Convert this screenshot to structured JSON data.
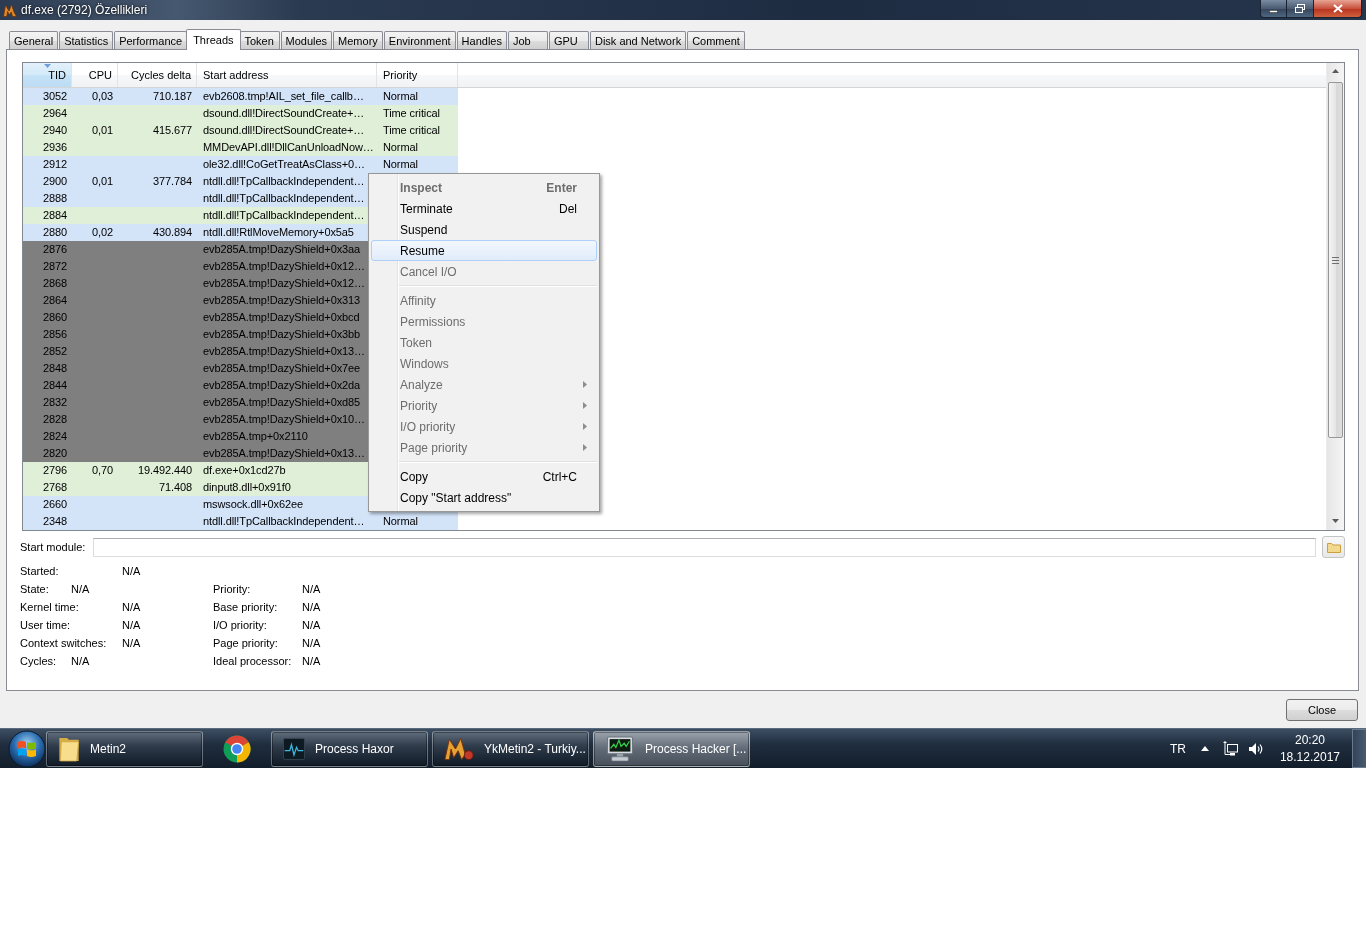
{
  "window": {
    "title": "df.exe (2792) Özellikleri"
  },
  "tabs": [
    {
      "label": "General",
      "selected": false
    },
    {
      "label": "Statistics",
      "selected": false
    },
    {
      "label": "Performance",
      "selected": false
    },
    {
      "label": "Threads",
      "selected": true
    },
    {
      "label": "Token",
      "selected": false
    },
    {
      "label": "Modules",
      "selected": false
    },
    {
      "label": "Memory",
      "selected": false
    },
    {
      "label": "Environment",
      "selected": false
    },
    {
      "label": "Handles",
      "selected": false
    },
    {
      "label": "Job",
      "selected": false
    },
    {
      "label": "GPU",
      "selected": false
    },
    {
      "label": "Disk and Network",
      "selected": false
    },
    {
      "label": "Comment",
      "selected": false
    }
  ],
  "threads": {
    "columns": [
      {
        "label": "TID",
        "kind": "number",
        "sorted": true
      },
      {
        "label": "CPU",
        "kind": "number",
        "sorted": false
      },
      {
        "label": "Cycles delta",
        "kind": "number",
        "sorted": false
      },
      {
        "label": "Start address",
        "kind": "text",
        "sorted": false
      },
      {
        "label": "Priority",
        "kind": "text",
        "sorted": false
      }
    ],
    "rows": [
      {
        "tid": "3052",
        "cpu": "0,03",
        "cycles_delta": "710.187",
        "start_address": "evb2608.tmp!AIL_set_file_callb…",
        "priority": "Normal",
        "color": "#d3e3f8"
      },
      {
        "tid": "2964",
        "start_address": "dsound.dll!DirectSoundCreate+…",
        "priority": "Time critical",
        "color": "#e0efd8"
      },
      {
        "tid": "2940",
        "cpu": "0,01",
        "cycles_delta": "415.677",
        "start_address": "dsound.dll!DirectSoundCreate+…",
        "priority": "Time critical",
        "color": "#e0efd8"
      },
      {
        "tid": "2936",
        "start_address": "MMDevAPI.dll!DllCanUnloadNow…",
        "priority": "Normal",
        "color": "#e0efd8"
      },
      {
        "tid": "2912",
        "start_address": "ole32.dll!CoGetTreatAsClass+0…",
        "priority": "Normal",
        "color": "#d3e3f8"
      },
      {
        "tid": "2900",
        "cpu": "0,01",
        "cycles_delta": "377.784",
        "start_address": "ntdll.dll!TpCallbackIndependent…",
        "color": "#d3e3f8"
      },
      {
        "tid": "2888",
        "start_address": "ntdll.dll!TpCallbackIndependent…",
        "color": "#d3e3f8"
      },
      {
        "tid": "2884",
        "start_address": "ntdll.dll!TpCallbackIndependent…",
        "color": "#e0efd8"
      },
      {
        "tid": "2880",
        "cpu": "0,02",
        "cycles_delta": "430.894",
        "start_address": "ntdll.dll!RtlMoveMemory+0x5a5",
        "color": "#d3e3f8"
      },
      {
        "tid": "2876",
        "start_address": "evb285A.tmp!DazyShield+0x3aa",
        "color": "#7f7f7f"
      },
      {
        "tid": "2872",
        "start_address": "evb285A.tmp!DazyShield+0x12…",
        "color": "#7f7f7f"
      },
      {
        "tid": "2868",
        "start_address": "evb285A.tmp!DazyShield+0x12…",
        "color": "#7f7f7f"
      },
      {
        "tid": "2864",
        "start_address": "evb285A.tmp!DazyShield+0x313",
        "color": "#7f7f7f"
      },
      {
        "tid": "2860",
        "start_address": "evb285A.tmp!DazyShield+0xbcd",
        "color": "#7f7f7f"
      },
      {
        "tid": "2856",
        "start_address": "evb285A.tmp!DazyShield+0x3bb",
        "color": "#7f7f7f"
      },
      {
        "tid": "2852",
        "start_address": "evb285A.tmp!DazyShield+0x13…",
        "color": "#7f7f7f"
      },
      {
        "tid": "2848",
        "start_address": "evb285A.tmp!DazyShield+0x7ee",
        "color": "#7f7f7f"
      },
      {
        "tid": "2844",
        "start_address": "evb285A.tmp!DazyShield+0x2da",
        "color": "#7f7f7f"
      },
      {
        "tid": "2832",
        "start_address": "evb285A.tmp!DazyShield+0xd85",
        "color": "#7f7f7f"
      },
      {
        "tid": "2828",
        "start_address": "evb285A.tmp!DazyShield+0x10…",
        "color": "#7f7f7f"
      },
      {
        "tid": "2824",
        "start_address": "evb285A.tmp+0x2110",
        "color": "#7f7f7f"
      },
      {
        "tid": "2820",
        "start_address": "evb285A.tmp!DazyShield+0x13…",
        "color": "#7f7f7f"
      },
      {
        "tid": "2796",
        "cpu": "0,70",
        "cycles_delta": "19.492.440",
        "start_address": "df.exe+0x1cd27b",
        "color": "#e0efd8"
      },
      {
        "tid": "2768",
        "cycles_delta": "71.408",
        "start_address": "dinput8.dll+0x91f0",
        "color": "#e0efd8"
      },
      {
        "tid": "2660",
        "start_address": "mswsock.dll+0x62ee",
        "color": "#d3e3f8"
      },
      {
        "tid": "2348",
        "start_address": "ntdll.dll!TpCallbackIndependent…",
        "priority": "Normal",
        "color": "#d3e3f8"
      }
    ]
  },
  "context_menu": {
    "items": [
      {
        "kind": "item",
        "label": "Inspect",
        "shortcut": "Enter",
        "disabled": true,
        "default": true,
        "highlighted": false,
        "submenu": false
      },
      {
        "kind": "item",
        "label": "Terminate",
        "shortcut": "Del",
        "disabled": false,
        "default": false,
        "highlighted": false,
        "submenu": false
      },
      {
        "kind": "item",
        "label": "Suspend",
        "disabled": false,
        "default": false,
        "highlighted": false,
        "submenu": false
      },
      {
        "kind": "item",
        "label": "Resume",
        "disabled": false,
        "default": false,
        "highlighted": true,
        "submenu": false
      },
      {
        "kind": "item",
        "label": "Cancel I/O",
        "disabled": true,
        "default": false,
        "highlighted": false,
        "submenu": false
      },
      {
        "kind": "separator"
      },
      {
        "kind": "item",
        "label": "Affinity",
        "disabled": true,
        "default": false,
        "highlighted": false,
        "submenu": false
      },
      {
        "kind": "item",
        "label": "Permissions",
        "disabled": true,
        "default": false,
        "highlighted": false,
        "submenu": false
      },
      {
        "kind": "item",
        "label": "Token",
        "disabled": true,
        "default": false,
        "highlighted": false,
        "submenu": false
      },
      {
        "kind": "item",
        "label": "Windows",
        "disabled": true,
        "default": false,
        "highlighted": false,
        "submenu": false
      },
      {
        "kind": "item",
        "label": "Analyze",
        "disabled": true,
        "default": false,
        "highlighted": false,
        "submenu": true
      },
      {
        "kind": "item",
        "label": "Priority",
        "disabled": true,
        "default": false,
        "highlighted": false,
        "submenu": true
      },
      {
        "kind": "item",
        "label": "I/O priority",
        "disabled": true,
        "default": false,
        "highlighted": false,
        "submenu": true
      },
      {
        "kind": "item",
        "label": "Page priority",
        "disabled": true,
        "default": false,
        "highlighted": false,
        "submenu": true
      },
      {
        "kind": "separator"
      },
      {
        "kind": "item",
        "label": "Copy",
        "shortcut": "Ctrl+C",
        "disabled": false,
        "default": false,
        "highlighted": false,
        "submenu": false
      },
      {
        "kind": "item",
        "label": "Copy \"Start address\"",
        "disabled": false,
        "default": false,
        "highlighted": false,
        "submenu": false
      }
    ]
  },
  "start_module": {
    "label": "Start module:"
  },
  "details": {
    "left": [
      {
        "label": "Started:",
        "value": "N/A",
        "kind": "aligned"
      },
      {
        "label": "State:",
        "value": "N/A",
        "kind": "inline"
      },
      {
        "label": "Kernel time:",
        "value": "N/A",
        "kind": "aligned"
      },
      {
        "label": "User time:",
        "value": "N/A",
        "kind": "aligned"
      },
      {
        "label": "Context switches:",
        "value": "N/A",
        "kind": "aligned"
      },
      {
        "label": "Cycles:",
        "value": "N/A",
        "kind": "inline"
      }
    ],
    "right": [
      {
        "label": "Priority:",
        "value": "N/A"
      },
      {
        "label": "Base priority:",
        "value": "N/A"
      },
      {
        "label": "I/O priority:",
        "value": "N/A"
      },
      {
        "label": "Page priority:",
        "value": "N/A"
      },
      {
        "label": "Ideal processor:",
        "value": "N/A"
      }
    ]
  },
  "buttons": [
    {
      "label": "Close"
    }
  ],
  "taskbar": {
    "items": [
      {
        "kind": "window",
        "label": "Metin2",
        "selected": false
      },
      {
        "kind": "pinned",
        "selected": false
      },
      {
        "kind": "window",
        "label": "Process Haxor",
        "selected": false
      },
      {
        "kind": "window",
        "label": "YkMetin2 - Turkiy...",
        "selected": false
      },
      {
        "kind": "window",
        "label": "Process Hacker [...",
        "selected": true
      }
    ],
    "language": "TR",
    "clock": {
      "time": "20:20",
      "date": "18.12.2017"
    }
  }
}
